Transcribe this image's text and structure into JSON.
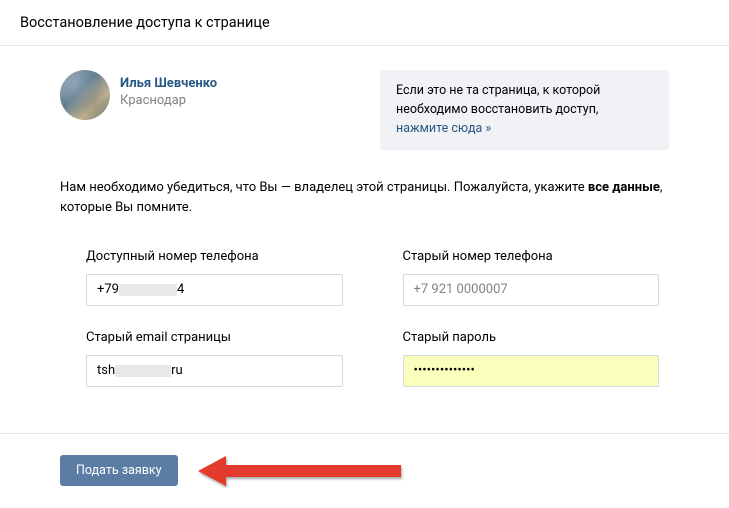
{
  "header": {
    "title": "Восстановление доступа к странице"
  },
  "user": {
    "name": "Илья Шевченко",
    "city": "Краснодар"
  },
  "notice": {
    "prefix": "Если это не та страница, к которой необходимо восстановить доступ, ",
    "link_text": "нажмите сюда »"
  },
  "instruction": {
    "part1": "Нам необходимо убедиться, что Вы — владелец этой страницы. Пожалуйста, укажите ",
    "bold": "все данные",
    "part2": ", которые Вы помните."
  },
  "form": {
    "available_phone": {
      "label": "Доступный номер телефона",
      "value_prefix": "+79",
      "value_suffix": "4",
      "redacted_width": 58
    },
    "old_phone": {
      "label": "Старый номер телефона",
      "placeholder": "+7 921 0000007",
      "value": ""
    },
    "old_email": {
      "label": "Старый email страницы",
      "value_prefix": "tsh",
      "value_suffix": "ru",
      "redacted_width": 56
    },
    "old_password": {
      "label": "Старый пароль",
      "value": "••••••••••••••"
    }
  },
  "submit": {
    "label": "Подать заявку"
  }
}
